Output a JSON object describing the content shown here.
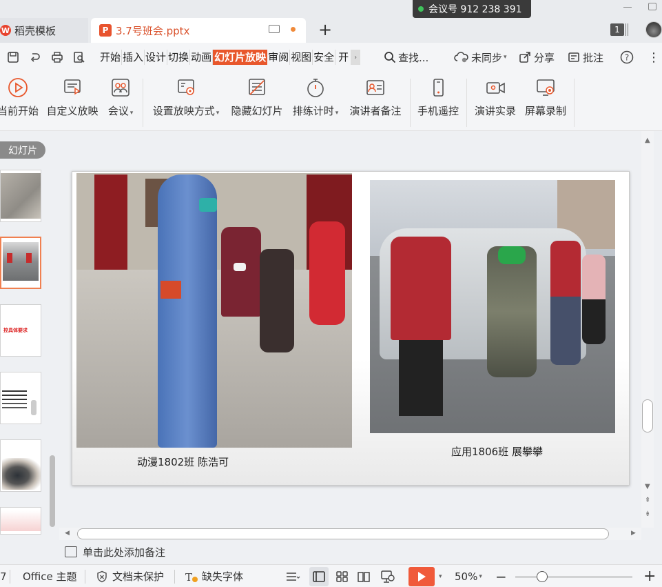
{
  "window": {
    "tab_inactive": "稻壳模板",
    "tab_active": "3.7号班会.pptx",
    "meeting": "会议号 912 238 391",
    "badge": "1"
  },
  "menu": {
    "items": [
      "开始",
      "插入",
      "设计",
      "切换",
      "动画",
      "幻灯片放映",
      "审阅",
      "视图",
      "安全",
      "开"
    ],
    "active_index": 5,
    "search": "查找...",
    "sync": "未同步",
    "share": "分享",
    "comment": "批注"
  },
  "ribbon": {
    "from_current": "当前开始",
    "custom_show": "自定义放映",
    "meeting": "会议",
    "setup_show": "设置放映方式",
    "hide_slide": "隐藏幻灯片",
    "rehearse": "排练计时",
    "presenter_notes": "演讲者备注",
    "phone_remote": "手机遥控",
    "record_presentation": "演讲实录",
    "screen_record": "屏幕录制"
  },
  "left_pane": {
    "pill": "幻灯片",
    "thumb3_text": "控具体要求"
  },
  "slide": {
    "caption_left": "动漫1802班 陈浩可",
    "caption_right": "应用1806班 展攀攀"
  },
  "notes": {
    "placeholder": "单击此处添加备注"
  },
  "status": {
    "slide_num": "7",
    "theme": "Office 主题",
    "protection": "文档未保护",
    "missing_font": "缺失字体",
    "zoom": "50%"
  }
}
